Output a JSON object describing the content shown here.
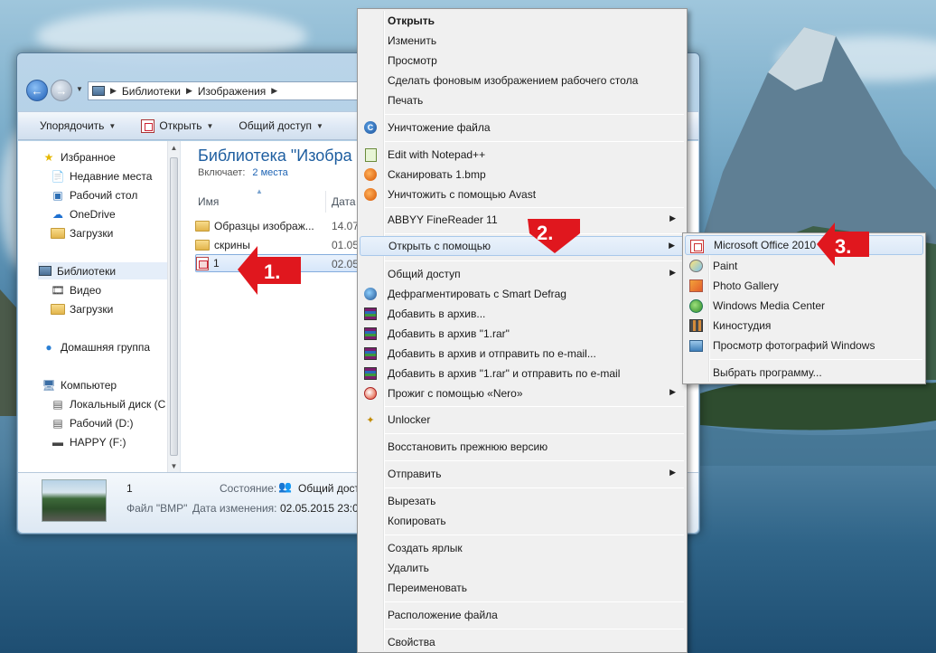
{
  "breadcrumb": {
    "part1": "Библиотеки",
    "part2": "Изображения"
  },
  "toolbar": {
    "organize": "Упорядочить",
    "open": "Открыть",
    "share": "Общий доступ"
  },
  "nav_pane": {
    "favorites": "Избранное",
    "recent": "Недавние места",
    "desktop": "Рабочий стол",
    "onedrive": "OneDrive",
    "downloads": "Загрузки",
    "libraries": "Библиотеки",
    "video": "Видео",
    "lib_downloads": "Загрузки",
    "homegroup": "Домашняя группа",
    "computer": "Компьютер",
    "local_disk": "Локальный диск (C",
    "disk_d": "Рабочий (D:)",
    "disk_f": "HAPPY (F:)"
  },
  "content": {
    "library_title": "Библиотека \"Изобра",
    "includes_label": "Включает:",
    "includes_link": "2 места",
    "col_name": "Имя",
    "col_date": "Дата",
    "files": [
      {
        "name": "Образцы изображ...",
        "date": "14.07"
      },
      {
        "name": "скрины",
        "date": "01.05"
      },
      {
        "name": "1",
        "date": "02.05"
      }
    ]
  },
  "details": {
    "file_name": "1",
    "file_type": "Файл \"BMP\"",
    "state_label": "Состояние:",
    "state_value": "Общий досту",
    "modified_label": "Дата изменения:",
    "modified_value": "02.05.2015 23:02"
  },
  "context_menu": [
    {
      "label": "Открыть",
      "bold": true
    },
    {
      "label": "Изменить"
    },
    {
      "label": "Просмотр"
    },
    {
      "label": "Сделать фоновым изображением рабочего стола"
    },
    {
      "label": "Печать"
    },
    {
      "label": "Уничтожение файла",
      "icon": "ccleaner-icon"
    },
    {
      "label": "Edit with Notepad++",
      "icon": "notepad-icon"
    },
    {
      "label": "Сканировать 1.bmp",
      "icon": "avast-icon"
    },
    {
      "label": "Уничтожить с помощью Avast",
      "icon": "avast-icon"
    },
    {
      "label": "ABBYY FineReader 11",
      "submenu": true
    },
    {
      "label": "Открыть с помощью",
      "submenu": true,
      "highlighted": true
    },
    {
      "label": "Общий доступ",
      "submenu": true
    },
    {
      "label": "Дефрагментировать с Smart Defrag",
      "icon": "defrag-icon"
    },
    {
      "label": "Добавить в архив...",
      "icon": "rar-icon"
    },
    {
      "label": "Добавить в архив \"1.rar\"",
      "icon": "rar-icon"
    },
    {
      "label": "Добавить в архив и отправить по e-mail...",
      "icon": "rar-icon"
    },
    {
      "label": "Добавить в архив \"1.rar\" и отправить по e-mail",
      "icon": "rar-icon"
    },
    {
      "label": "Прожиг с помощью «Nero»",
      "icon": "nero-icon",
      "submenu": true
    },
    {
      "label": "Unlocker",
      "icon": "unlocker-icon"
    },
    {
      "label": "Восстановить прежнюю версию"
    },
    {
      "label": "Отправить",
      "submenu": true
    },
    {
      "label": "Вырезать"
    },
    {
      "label": "Копировать"
    },
    {
      "label": "Создать ярлык"
    },
    {
      "label": "Удалить"
    },
    {
      "label": "Переименовать"
    },
    {
      "label": "Расположение файла"
    },
    {
      "label": "Свойства"
    }
  ],
  "open_with_submenu": [
    {
      "label": "Microsoft Office 2010",
      "icon": "office-icon",
      "highlighted": true
    },
    {
      "label": "Paint",
      "icon": "paint-icon"
    },
    {
      "label": "Photo Gallery",
      "icon": "photo-gallery-icon"
    },
    {
      "label": "Windows Media Center",
      "icon": "media-center-icon"
    },
    {
      "label": "Киностудия",
      "icon": "movie-maker-icon"
    },
    {
      "label": "Просмотр фотографий Windows",
      "icon": "photo-viewer-icon"
    },
    {
      "label": "Выбрать программу..."
    }
  ],
  "callouts": {
    "step1": "1.",
    "step2": "2.",
    "step3": "3."
  },
  "colors": {
    "callout_red": "#e0171e",
    "library_title": "#1e5ea0",
    "menu_bg": "#f0f0f0"
  }
}
